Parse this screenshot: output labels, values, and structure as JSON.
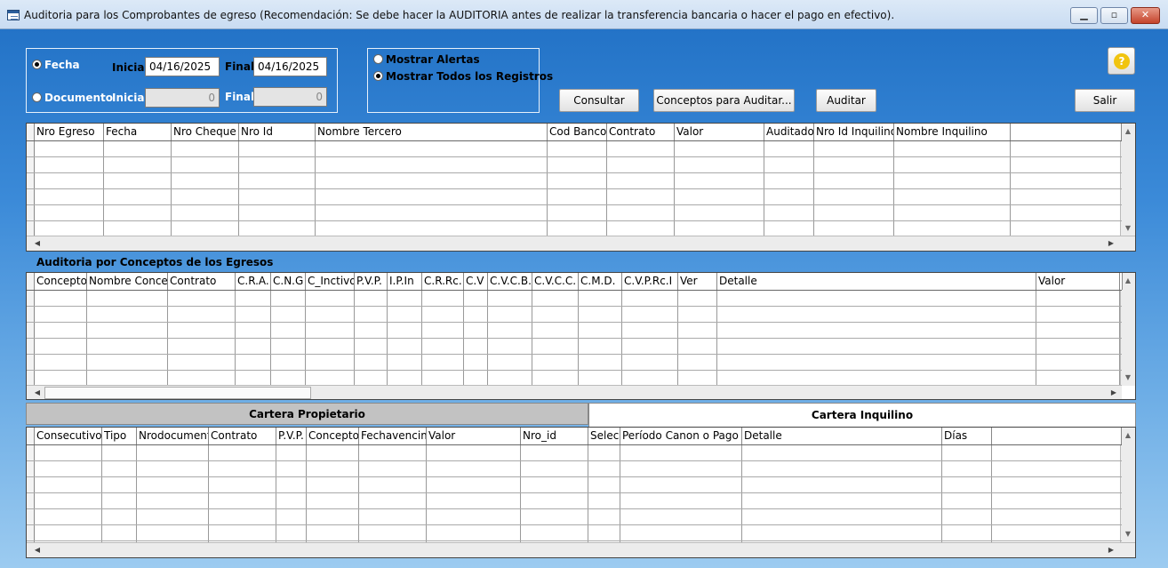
{
  "window": {
    "title": "Auditoria para los Comprobantes de egreso (Recomendación: Se debe hacer la AUDITORIA antes de realizar la transferencia bancaria o hacer el pago en efectivo).",
    "minimize": "▁",
    "maximize": "▫",
    "close": "✕"
  },
  "filter": {
    "fecha_label": "Fecha",
    "documento_label": "Documento",
    "inicial_label": "Inicial",
    "final_label": "Final",
    "fecha_inicial": "04/16/2025",
    "fecha_final": "04/16/2025",
    "doc_inicial": "0",
    "doc_final": "0",
    "selected": "Fecha"
  },
  "mode": {
    "alertas_label": "Mostrar Alertas",
    "todos_label": "Mostrar Todos los Registros",
    "selected": "todos"
  },
  "buttons": {
    "consultar": "Consultar",
    "conceptos": "Conceptos para Auditar...",
    "auditar": "Auditar",
    "salir": "Salir",
    "help": "?"
  },
  "grid1": {
    "columns": [
      "Nro Egreso",
      "Fecha",
      "Nro Cheque",
      "Nro Id",
      "Nombre Tercero",
      "Cod Banco",
      "Contrato",
      "Valor",
      "Auditado",
      "Nro Id Inquilino",
      "Nombre Inquilino"
    ]
  },
  "section2": {
    "title": "Auditoria por Conceptos de los Egresos"
  },
  "grid2": {
    "columns": [
      "Concepto",
      "Nombre Concepto",
      "Contrato",
      "C.R.A.",
      "C.N.G",
      "C_Inctivo",
      "P.V.P.",
      "I.P.In",
      "C.R.Rc.",
      "C.V",
      "C.V.C.B.",
      "C.V.C.C.",
      "C.M.D.",
      "C.V.P.Rc.I",
      "Ver",
      "Detalle",
      "Valor"
    ]
  },
  "tabs": {
    "propietario": "Cartera Propietario",
    "inquilino": "Cartera Inquilino",
    "active": "inquilino"
  },
  "grid3": {
    "columns": [
      "Consecutivo",
      "Tipo",
      "Nrodocumento",
      "Contrato",
      "P.V.P.",
      "Concepto",
      "Fechavencimiento",
      "Valor",
      "Nro_id",
      "Selec",
      "Período Canon o Pago",
      "Detalle",
      "Días"
    ]
  },
  "scroll": {
    "up": "▲",
    "down": "▼",
    "left": "◀",
    "right": "▶"
  }
}
